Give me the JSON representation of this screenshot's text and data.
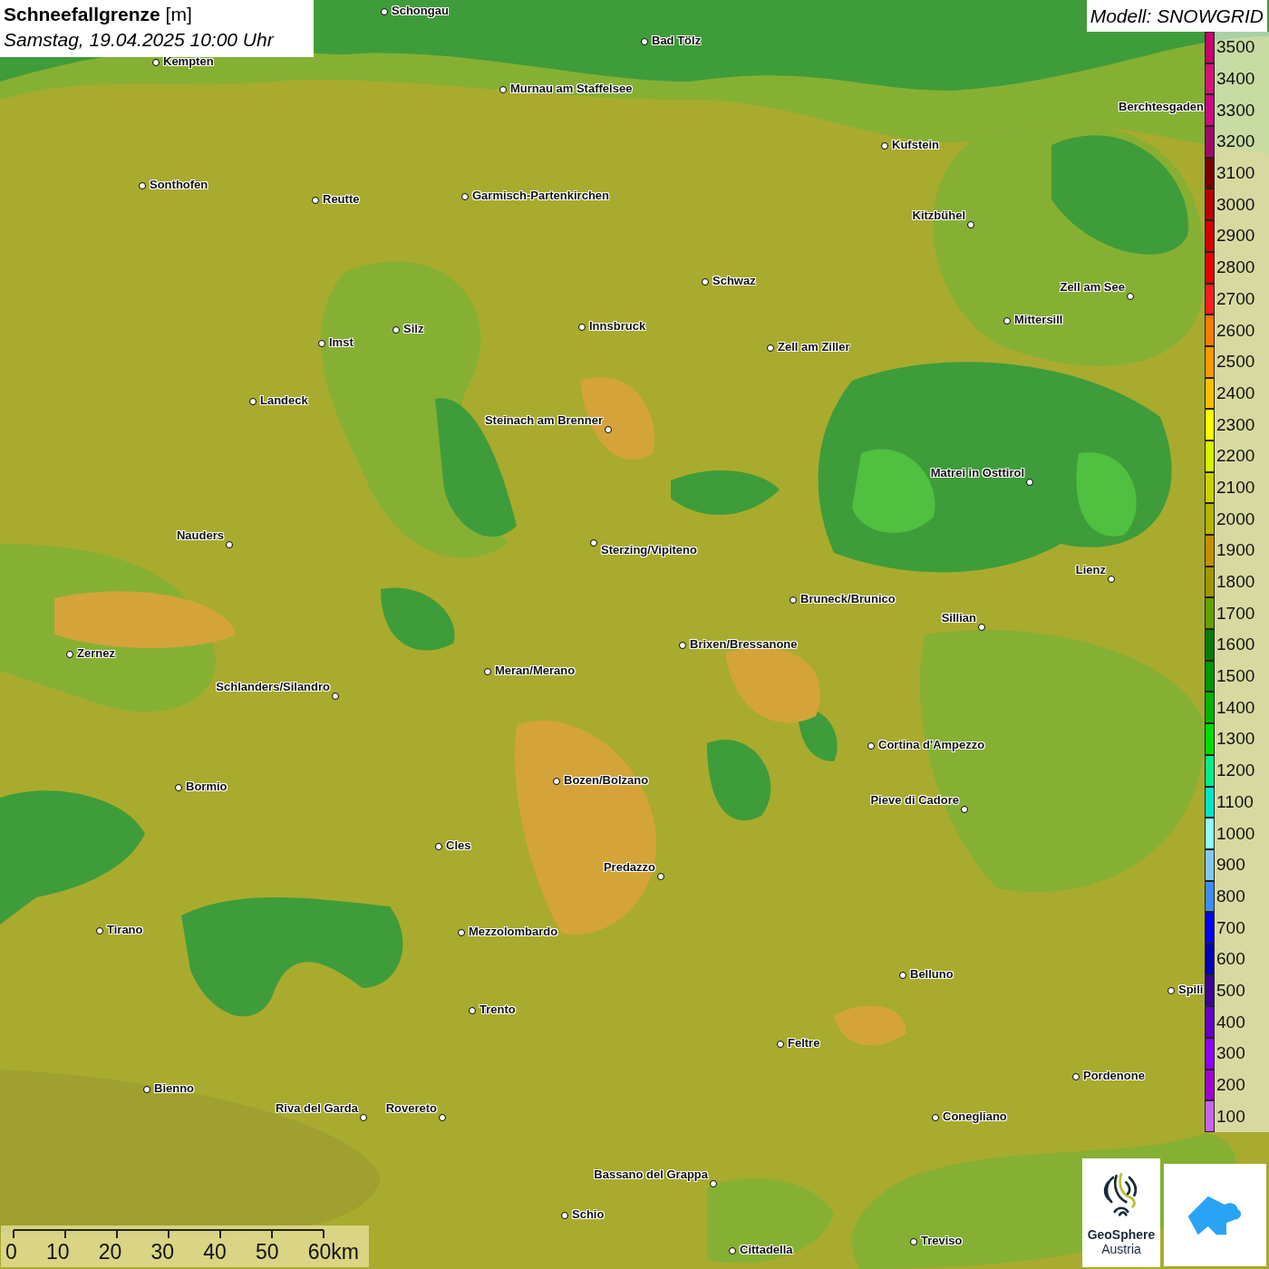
{
  "title": {
    "name": "Schneefallgrenze",
    "unit": "[m]",
    "date": "Samstag, 19.04.2025 10:00 Uhr"
  },
  "model": "Modell: SNOWGRID",
  "cities": [
    "Schongau",
    "Bad Tölz",
    "Kempten",
    "Murnau am Staffelsee",
    "Berchtesgaden",
    "Kufstein",
    "Sonthofen",
    "Garmisch-Partenkirchen",
    "Reutte",
    "Kitzbühel",
    "Schwaz",
    "Zell am See",
    "Mittersill",
    "Innsbruck",
    "Silz",
    "Imst",
    "Zell am Ziller",
    "Landeck",
    "Steinach am Brenner",
    "Matrei in Osttirol",
    "Nauders",
    "Sterzing/Vipiteno",
    "Lienz",
    "Bruneck/Brunico",
    "Sillian",
    "Brixen/Bressanone",
    "Zernez",
    "Meran/Merano",
    "Schlanders/Silandro",
    "Cortina d'Ampezzo",
    "Bozen/Bolzano",
    "Bormio",
    "Pieve di Cadore",
    "Cles",
    "Predazzo",
    "Tirano",
    "Mezzolombardo",
    "Belluno",
    "Spili",
    "Trento",
    "Feltre",
    "Pordenone",
    "Bienno",
    "Riva del Garda",
    "Rovereto",
    "Conegliano",
    "Bassano del Grappa",
    "Schio",
    "Treviso",
    "Cittadella"
  ],
  "legend": [
    {
      "label": "3500",
      "color": "#c8006e"
    },
    {
      "label": "3400",
      "color": "#d4147a"
    },
    {
      "label": "3300",
      "color": "#c80a82"
    },
    {
      "label": "3200",
      "color": "#a0086e"
    },
    {
      "label": "3100",
      "color": "#780000"
    },
    {
      "label": "3000",
      "color": "#b40000"
    },
    {
      "label": "2900",
      "color": "#d20000"
    },
    {
      "label": "2800",
      "color": "#e60000"
    },
    {
      "label": "2700",
      "color": "#ff1e1e"
    },
    {
      "label": "2600",
      "color": "#ff7800"
    },
    {
      "label": "2500",
      "color": "#ff9600"
    },
    {
      "label": "2400",
      "color": "#ffbe00"
    },
    {
      "label": "2300",
      "color": "#ffff00"
    },
    {
      "label": "2200",
      "color": "#d2f500"
    },
    {
      "label": "2100",
      "color": "#c8d200"
    },
    {
      "label": "2000",
      "color": "#b4b400"
    },
    {
      "label": "1900",
      "color": "#c09000"
    },
    {
      "label": "1800",
      "color": "#a09600"
    },
    {
      "label": "1700",
      "color": "#64a000"
    },
    {
      "label": "1600",
      "color": "#0a7a00"
    },
    {
      "label": "1500",
      "color": "#009600"
    },
    {
      "label": "1400",
      "color": "#00b400"
    },
    {
      "label": "1300",
      "color": "#00dc00"
    },
    {
      "label": "1200",
      "color": "#00f08c"
    },
    {
      "label": "1100",
      "color": "#00e6c8"
    },
    {
      "label": "1000",
      "color": "#8cffff"
    },
    {
      "label": "900",
      "color": "#82c8f0"
    },
    {
      "label": "800",
      "color": "#3c8cff"
    },
    {
      "label": "700",
      "color": "#0000ff"
    },
    {
      "label": "600",
      "color": "#0000b4"
    },
    {
      "label": "500",
      "color": "#3c0096"
    },
    {
      "label": "400",
      "color": "#6400c8"
    },
    {
      "label": "300",
      "color": "#8c00ff"
    },
    {
      "label": "200",
      "color": "#a000d2"
    },
    {
      "label": "100",
      "color": "#c864f0"
    }
  ],
  "scale": [
    "0",
    "10",
    "20",
    "30",
    "40",
    "50",
    "60km"
  ],
  "logos": {
    "geosphere": {
      "line1": "GeoSphere",
      "line2": "Austria"
    }
  }
}
